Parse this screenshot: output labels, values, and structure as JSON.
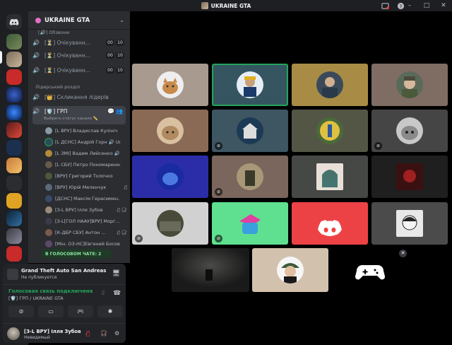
{
  "titlebar": {
    "title": "UKRAINE GTA"
  },
  "server": {
    "name": "UKRAINE GTA"
  },
  "channels": {
    "group_label": "[🔊] Обзвони",
    "waiting": [
      {
        "prefix": "[⏳]",
        "label": "Очікуванн...",
        "count_a": "00",
        "count_b": "10"
      },
      {
        "prefix": "[⏳]",
        "label": "Очікуванн...",
        "count_a": "00",
        "count_b": "10"
      },
      {
        "prefix": "[⏳]",
        "label": "Очікуванн...",
        "count_a": "00",
        "count_b": "10"
      }
    ],
    "category": "Лідерський розділ",
    "leaders": {
      "prefix": "[👑]",
      "label": "Скликання лідерів"
    },
    "active": {
      "prefix": "[🛡️]",
      "label": "ГРП",
      "status": "Выбрать статус канала ✏️"
    }
  },
  "members": [
    "[L ВРУ] Владислав Кулініч",
    "[L ДСНС] Андрій Горн 🔊 Ur",
    "[L ЗМІ] Вадим Лийсенко 🔊",
    "[L СБУ] Петро Пономаренко",
    "[ВРУ] Григорий Толочко",
    "[ВРУ] Юрій Меленчук",
    "[ДСНС] Максім Герасимен...",
    "[З-L ВРУ] Ілля Зубов",
    "[З-L[ГОЛ НААУ]ВРУ] Морг...",
    "[К-ДБР СБУ] Антон ...",
    "[Мін. ОЗ-НС]Евгений Босов"
  ],
  "voice_chat_label": "В ГОЛОСОВОМ ЧАТЕ: 2",
  "activity": {
    "game": "Grand Theft Auto San Andreas",
    "status": "Не публикуется"
  },
  "voice": {
    "connected": "Голосовая связь подключена",
    "channel": "[🛡️] ГРП / UKRAINE GTA"
  },
  "user": {
    "name": "[З-L ВРУ] Ілля Зубов",
    "status": "Невидимый"
  },
  "colors": {
    "speaking": "#23a55a",
    "danger": "#f23f43",
    "blurple": "#5865f2"
  }
}
